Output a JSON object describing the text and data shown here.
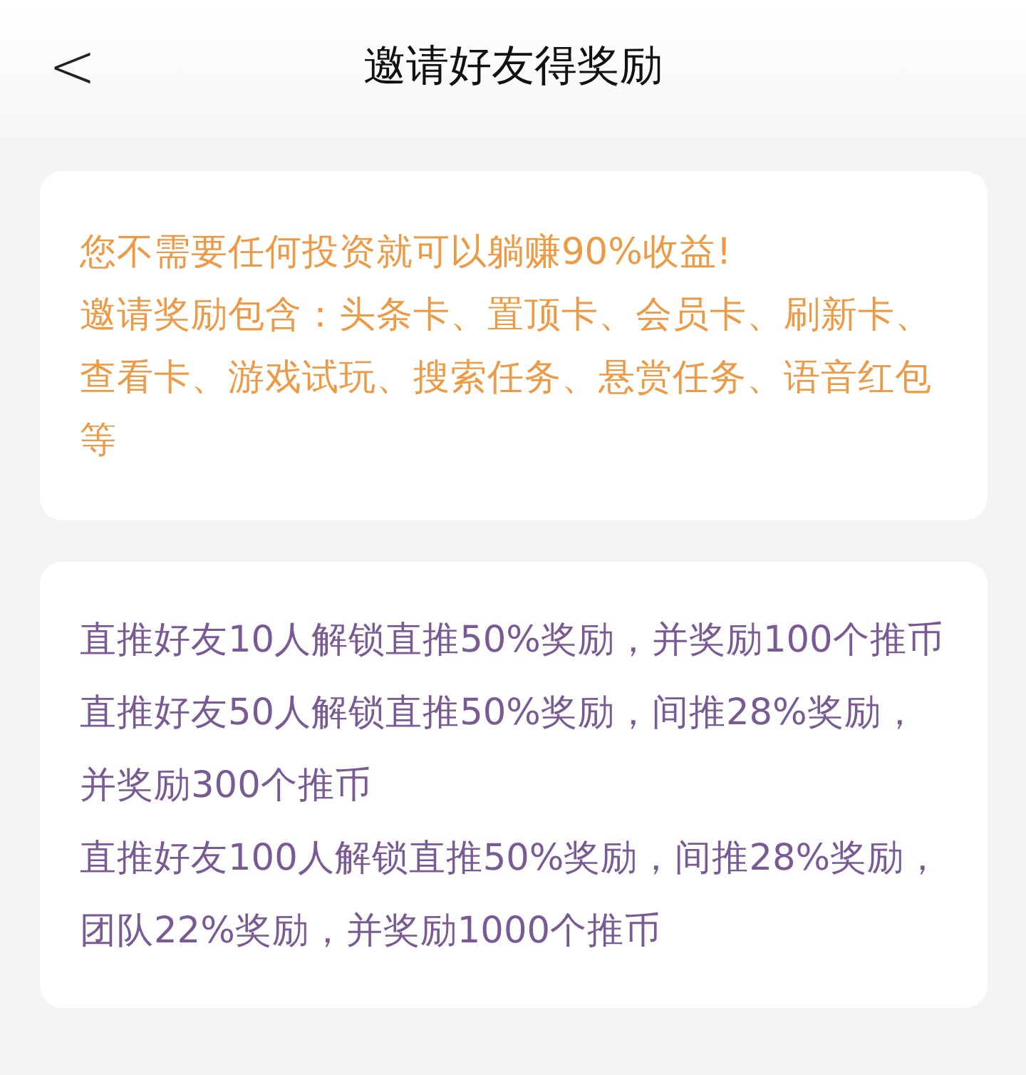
{
  "header": {
    "back_icon": "<",
    "title": "邀请好友得奖励"
  },
  "intro_card": {
    "paragraphs": [
      "您不需要任何投资就可以躺赚90%收益!",
      "邀请奖励包含：头条卡、置顶卡、会员卡、刷新卡、查看卡、游戏试玩、搜索任务、悬赏任务、语音红包等"
    ]
  },
  "reward_card": {
    "paragraphs": [
      "直推好友10人解锁直推50%奖励，并奖励100个推币",
      "直推好友50人解锁直推50%奖励，间推28%奖励，并奖励300个推币",
      "直推好友100人解锁直推50%奖励，间推28%奖励，团队22%奖励，并奖励1000个推币"
    ]
  }
}
